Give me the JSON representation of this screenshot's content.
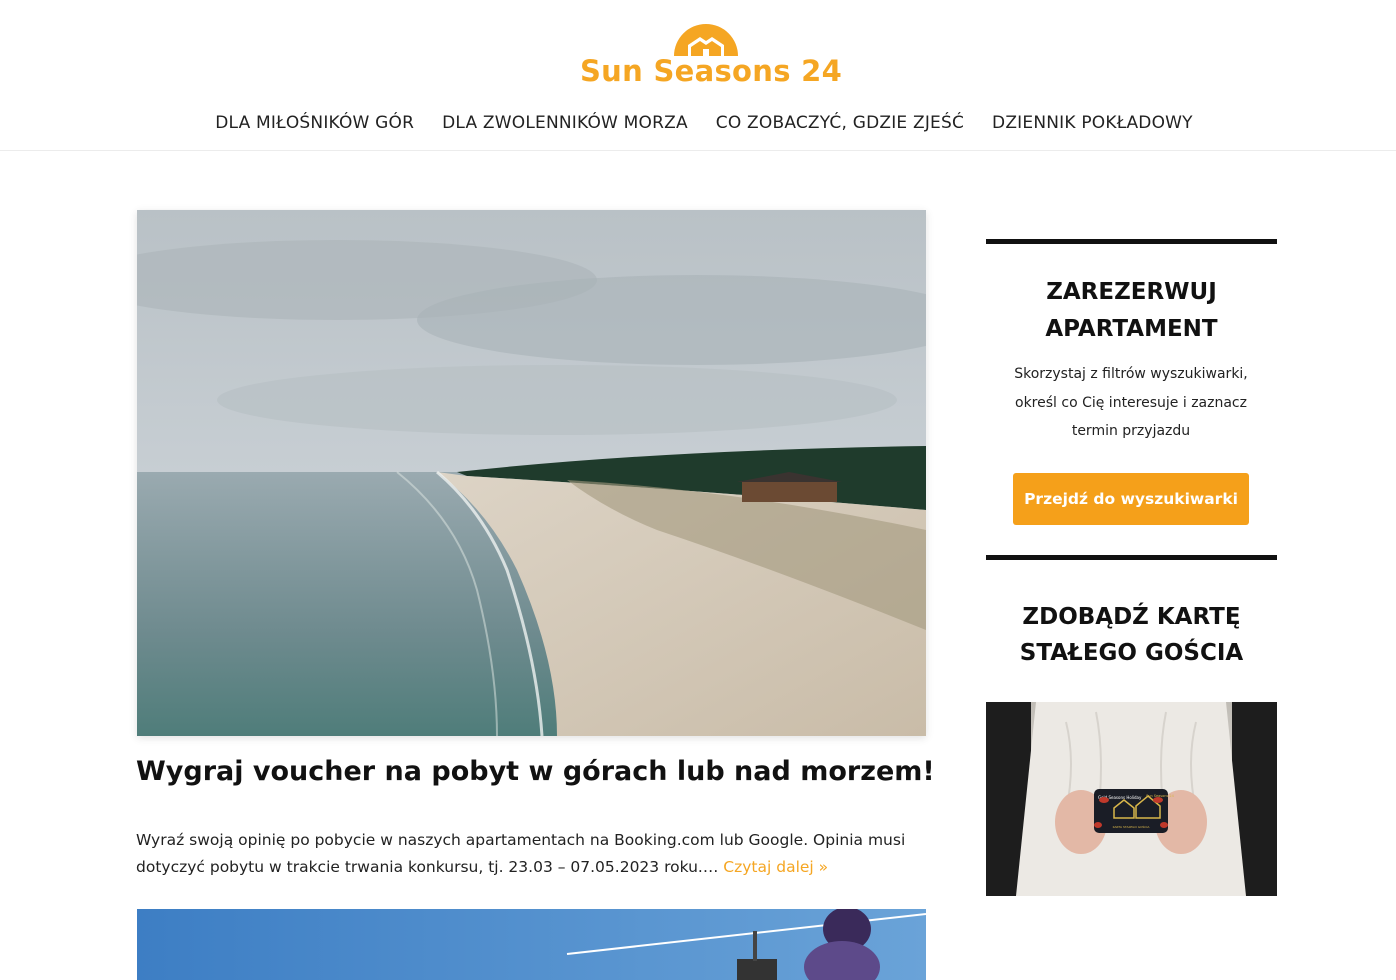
{
  "site": {
    "logo_text": "Sun Seasons 24",
    "brand_color": "#f5a623"
  },
  "nav": {
    "items": [
      {
        "label": "DLA MIŁOŚNIKÓW GÓR"
      },
      {
        "label": "DLA ZWOLENNIKÓW MORZA"
      },
      {
        "label": "CO ZOBACZYĆ, GDZIE ZJEŚĆ"
      },
      {
        "label": "DZIENNIK POKŁADOWY"
      }
    ]
  },
  "post": {
    "title": "Wygraj voucher na pobyt w górach lub nad morzem!",
    "excerpt": "Wyraź swoją opinię po pobycie w naszych apartamentach na Booking.com lub Google. Opinia musi dotyczyć pobytu w trakcie trwania konkursu, tj. 23.03 – 07.05.2023 roku.…",
    "read_more": "Czytaj dalej »",
    "read_more_color": "#f5a623"
  },
  "sidebar": {
    "booking_heading_line1": "ZAREZERWUJ",
    "booking_heading_line2": "APARTAMENT",
    "booking_text": "Skorzystaj z filtrów wyszukiwarki, określ co Cię interesuje i zaznacz termin przyjazdu",
    "booking_button": "Przejdź do wyszukiwarki",
    "button_color": "#f5a01a",
    "card_heading_line1": "ZDOBĄDŹ KARTĘ",
    "card_heading_line2": "STAŁEGO GOŚCIA",
    "card_logo_text": "Sun Seasons 24",
    "card_small_text": "Gold Seasons Holiday",
    "card_tagline": "KARTA STAŁEGO GOŚCIA"
  }
}
